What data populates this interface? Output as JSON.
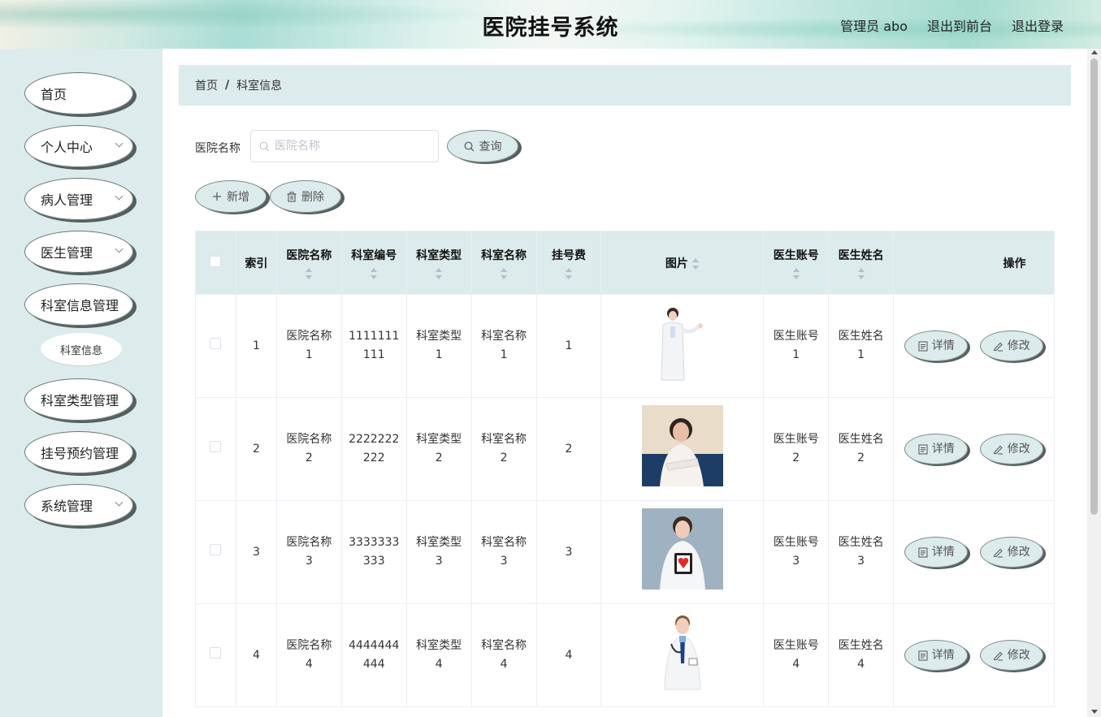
{
  "header": {
    "title": "医院挂号系统",
    "admin_label": "管理员 abo",
    "front_label": "退出到前台",
    "logout_label": "退出登录"
  },
  "sidebar": {
    "items": [
      {
        "label": "首页"
      },
      {
        "label": "个人中心"
      },
      {
        "label": "病人管理"
      },
      {
        "label": "医生管理"
      },
      {
        "label": "科室信息管理"
      },
      {
        "label": "科室类型管理"
      },
      {
        "label": "挂号预约管理"
      },
      {
        "label": "系统管理"
      }
    ],
    "sub_item": "科室信息"
  },
  "breadcrumb": {
    "home": "首页",
    "sep": "/",
    "current": "科室信息"
  },
  "search": {
    "label": "医院名称",
    "placeholder": "医院名称",
    "value": "",
    "button": "查询"
  },
  "toolbar": {
    "add_label": "新增",
    "delete_label": "删除"
  },
  "table": {
    "headers": {
      "index": "索引",
      "hospital": "医院名称",
      "dept_no": "科室编号",
      "dept_type": "科室类型",
      "dept_name": "科室名称",
      "fee": "挂号费",
      "image": "图片",
      "doctor_account": "医生账号",
      "doctor_name": "医生姓名",
      "ops": "操作"
    },
    "rows": [
      {
        "index": "1",
        "hospital": "医院名称1",
        "dept_no": "1111111111",
        "dept_type": "科室类型1",
        "dept_name": "科室名称1",
        "fee": "1",
        "doctor_account": "医生账号1",
        "doctor_name": "医生姓名1"
      },
      {
        "index": "2",
        "hospital": "医院名称2",
        "dept_no": "2222222222",
        "dept_type": "科室类型2",
        "dept_name": "科室名称2",
        "fee": "2",
        "doctor_account": "医生账号2",
        "doctor_name": "医生姓名2"
      },
      {
        "index": "3",
        "hospital": "医院名称3",
        "dept_no": "3333333333",
        "dept_type": "科室类型3",
        "dept_name": "科室名称3",
        "fee": "3",
        "doctor_account": "医生账号3",
        "doctor_name": "医生姓名3"
      },
      {
        "index": "4",
        "hospital": "医院名称4",
        "dept_no": "4444444444",
        "dept_type": "科室类型4",
        "dept_name": "科室名称4",
        "fee": "4",
        "doctor_account": "医生账号4",
        "doctor_name": "医生姓名4"
      }
    ],
    "detail_label": "详情",
    "edit_label": "修改"
  },
  "colors": {
    "accent": "#dcebeb",
    "shadow": "#555f5f"
  }
}
